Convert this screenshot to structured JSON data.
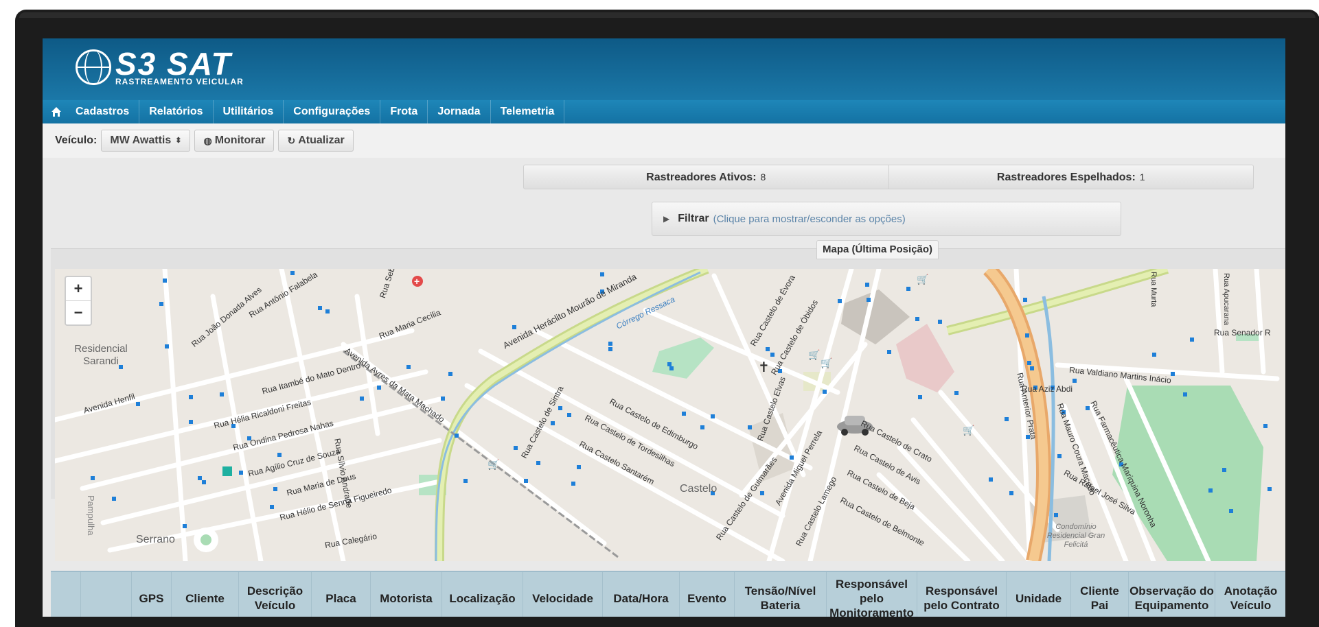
{
  "logo": {
    "brand": "S3 SAT",
    "tagline": "RASTREAMENTO VEICULAR"
  },
  "nav": {
    "items": [
      "Cadastros",
      "Relatórios",
      "Utilitários",
      "Configurações",
      "Frota",
      "Jornada",
      "Telemetria"
    ]
  },
  "toolbar": {
    "vehicle_label": "Veículo:",
    "vehicle_value": "MW Awattis",
    "monitor_label": "Monitorar",
    "refresh_label": "Atualizar"
  },
  "stats": {
    "active_label": "Rastreadores Ativos:",
    "active_value": "8",
    "mirrored_label": "Rastreadores Espelhados:",
    "mirrored_value": "1"
  },
  "filter": {
    "title": "Filtrar",
    "hint": "(Clique para mostrar/esconder as opções)"
  },
  "map": {
    "tab_label": "Mapa (Última Posição)",
    "zoom_in": "+",
    "zoom_out": "−",
    "labels": {
      "residencial_sarandi": "Residencial Sarandi",
      "castelo": "Castelo",
      "serrano": "Serrano",
      "pampulha": "Pampulha",
      "condominio": "Condomínio Residencial Gran Felicitá",
      "av_heraclito": "Avenida Heráclito Mourão de Miranda",
      "corrego_ressaca": "Córrego Ressaca",
      "av_henfil": "Avenida Henfil",
      "av_ayres": "Avenida Ayres da Mata Machado",
      "rua_itambe": "Rua Itambé do Mato Dentro",
      "rua_helia": "Rua Hélia Ricaldoni Freitas",
      "rua_ondina": "Rua Ondina Pedrosa Nahas",
      "rua_agilio": "Rua Agílio Cruz de Souza",
      "rua_maria_deus": "Rua Maria de Deus",
      "rua_helio": "Rua Hélio de Senna Figueiredo",
      "rua_silvio": "Rua Sílvio Andrade",
      "rua_joao": "Rua João Donada Alves",
      "rua_antonio": "Rua Antônio Falabela",
      "rua_maria_cecilia": "Rua Maria Cecília",
      "rua_virgilio": "Rua Sebastião Virgílio Távora",
      "rua_evora": "Rua Castelo de Évora",
      "rua_obidos": "Rua Castelo de Óbidos",
      "rua_elvas": "Rua Castelo Elvas",
      "rua_edimburgo": "Rua Castelo de Edimburgo",
      "rua_tordesilhas": "Rua Castelo de Tordesilhas",
      "rua_santarem": "Rua Castelo Santarém",
      "rua_sintra": "Rua Castelo de Sintra",
      "rua_guimaraes": "Rua Castelo de Guimarães",
      "av_miguel": "Avenida Miguel Perrela",
      "rua_crato": "Rua Castelo de Crato",
      "rua_avis": "Rua Castelo de Avis",
      "rua_beja": "Rua Castelo de Beja",
      "rua_belmonte": "Rua Castelo de Belmonte",
      "rua_lamego": "Rua Castelo Lamego",
      "rua_valdiano": "Rua Valdiano Martins Inácio",
      "rua_aziz": "Rua Aziz Abdi",
      "rua_anterior": "Rua Anterior Prata",
      "rua_mauro": "Rua Mauro Coura Macedo",
      "rua_farmaceutica": "Rua Farmacêutica Mariquina Noronha",
      "rua_rafael": "Rua Rafael José Silva",
      "rua_senador": "Rua Senador R",
      "rua_apucarana": "Rua Apucarana",
      "rua_murta": "Rua Murta",
      "rua_calegario": "Rua Calegário"
    }
  },
  "table": {
    "headers": [
      "",
      "",
      "GPS",
      "Cliente",
      "Descrição Veículo",
      "Placa",
      "Motorista",
      "Localização",
      "Velocidade",
      "Data/Hora",
      "Evento",
      "Tensão/Nível Bateria",
      "Responsável pelo Monitoramento",
      "Responsável pelo Contrato",
      "Unidade",
      "Cliente Pai",
      "Observação do Equipamento",
      "Anotação Veículo"
    ]
  }
}
